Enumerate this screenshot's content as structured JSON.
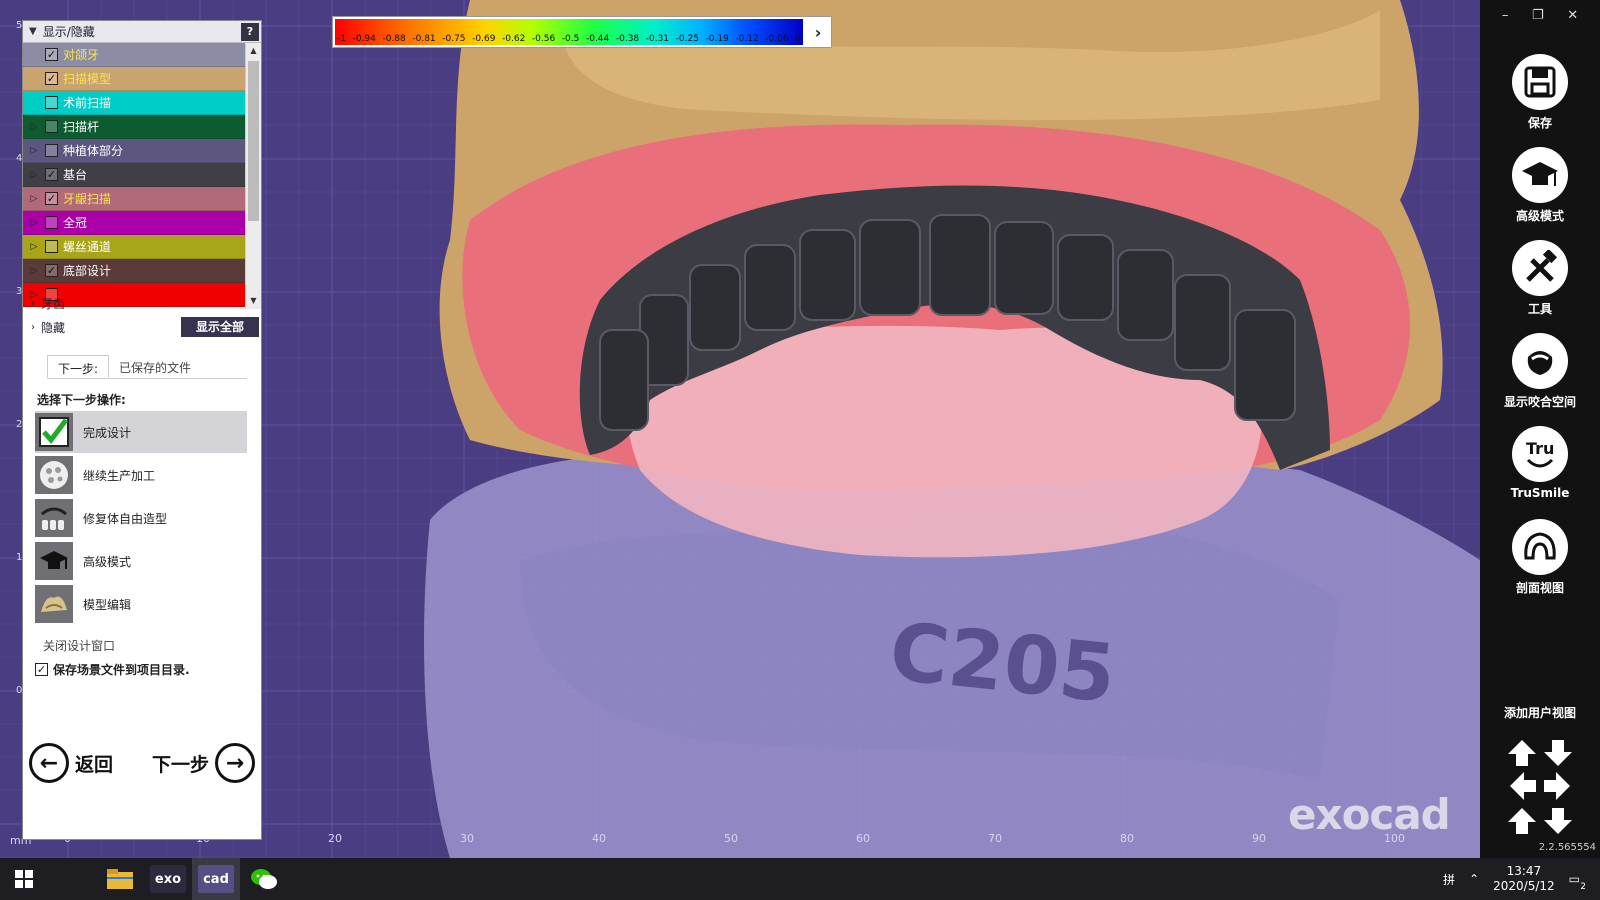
{
  "colorbar": {
    "ticks": [
      "-1",
      "-0.94",
      "-0.88",
      "-0.81",
      "-0.75",
      "-0.69",
      "-0.62",
      "-0.56",
      "-0.5",
      "-0.44",
      "-0.38",
      "-0.31",
      "-0.25",
      "-0.19",
      "-0.12",
      "-0.06",
      "0"
    ],
    "expand_icon": "chevron-right-icon"
  },
  "ruler": {
    "unit": "mm",
    "x_labels": [
      "0",
      "10",
      "20",
      "30",
      "40",
      "50",
      "60",
      "70",
      "80",
      "90",
      "100"
    ],
    "y_labels": [
      "5",
      "4",
      "3",
      "2",
      "1",
      "0"
    ]
  },
  "watermark": "exocad",
  "visibility_panel": {
    "title": "显示/隐藏",
    "help": "?",
    "layers": [
      {
        "label": "对颌牙",
        "checked": true,
        "expandable": false,
        "bg": "#8c8ca4",
        "fg": "#f7e64a"
      },
      {
        "label": "扫描模型",
        "checked": true,
        "expandable": false,
        "bg": "#c9a46f",
        "fg": "#f7e64a"
      },
      {
        "label": "术前扫描",
        "checked": false,
        "expandable": false,
        "bg": "#00cdc5",
        "fg": "#ffffff"
      },
      {
        "label": "扫描杆",
        "checked": false,
        "expandable": true,
        "bg": "#0d5c31",
        "fg": "#ffffff"
      },
      {
        "label": "种植体部分",
        "checked": false,
        "expandable": true,
        "bg": "#5d577f",
        "fg": "#ffffff"
      },
      {
        "label": "基台",
        "checked": true,
        "expandable": true,
        "bg": "#3f3f45",
        "fg": "#ffffff"
      },
      {
        "label": "牙龈扫描",
        "checked": true,
        "expandable": true,
        "bg": "#b26a7a",
        "fg": "#f7e64a"
      },
      {
        "label": "全冠",
        "checked": false,
        "expandable": true,
        "bg": "#ab00a8",
        "fg": "#ffffff"
      },
      {
        "label": "螺丝通道",
        "checked": false,
        "expandable": true,
        "bg": "#a9a51a",
        "fg": "#ffffff"
      },
      {
        "label": "底部设计",
        "checked": true,
        "expandable": true,
        "bg": "#5b3a3a",
        "fg": "#ffffff"
      },
      {
        "label": "",
        "checked": false,
        "expandable": true,
        "bg": "#f00000",
        "fg": "#ffffff"
      }
    ],
    "groups": [
      "牙齿",
      "隐藏"
    ],
    "show_all": "显示全部"
  },
  "wizard": {
    "tabs": [
      "下一步:",
      "已保存的文件"
    ],
    "section_title": "选择下一步操作:",
    "actions": [
      {
        "label": "完成设计",
        "icon": "checkmark-icon",
        "selected": true
      },
      {
        "label": "继续生产加工",
        "icon": "milling-disc-icon",
        "selected": false
      },
      {
        "label": "修复体自由造型",
        "icon": "freeform-teeth-icon",
        "selected": false
      },
      {
        "label": "高级模式",
        "icon": "graduation-cap-icon",
        "selected": false
      },
      {
        "label": "模型编辑",
        "icon": "model-edit-icon",
        "selected": false
      }
    ],
    "close_window": "关闭设计窗口",
    "save_scene": "保存场景文件到项目目录.",
    "save_scene_checked": true,
    "back": "返回",
    "next": "下一步"
  },
  "toolbar": {
    "window_controls": [
      "–",
      "❐",
      "✕"
    ],
    "tools": [
      {
        "label": "保存",
        "icon": "save-disk-icon"
      },
      {
        "label": "高级模式",
        "icon": "graduation-cap-icon"
      },
      {
        "label": "工具",
        "icon": "tools-icon"
      },
      {
        "label": "显示咬合空间",
        "icon": "occlusion-space-icon"
      },
      {
        "label": "TruSmile",
        "icon": "trusmile-icon"
      },
      {
        "label": "剖面视图",
        "icon": "section-view-icon"
      }
    ],
    "add_user_view": "添加用户视图",
    "version": "2.2.565554"
  },
  "taskbar": {
    "apps": [
      {
        "name": "windows-start-icon",
        "label": ""
      },
      {
        "name": "file-explorer-icon",
        "label": ""
      },
      {
        "name": "exo-app-icon",
        "label": "exo"
      },
      {
        "name": "cad-app-icon",
        "label": "cad"
      },
      {
        "name": "wechat-icon",
        "label": ""
      }
    ],
    "ime": "拼",
    "time": "13:47",
    "date": "2020/5/12",
    "notifications": "2"
  },
  "colors": {
    "viewport_bg": "#4b3d82",
    "grid_line": "#6b5fb0",
    "toolbar_bg": "#121212"
  }
}
